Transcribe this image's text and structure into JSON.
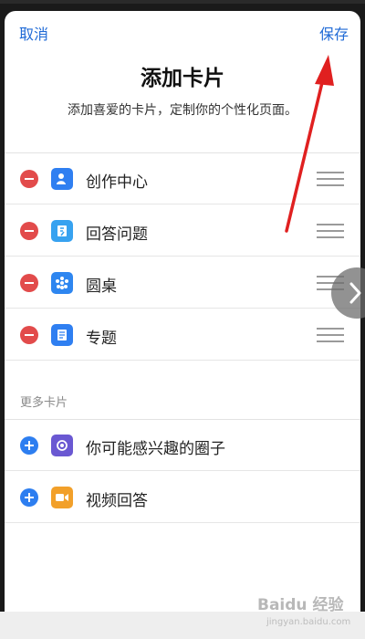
{
  "header": {
    "cancel_label": "取消",
    "save_label": "保存",
    "title": "添加卡片",
    "subtitle": "添加喜爱的卡片，定制你的个性化页面。"
  },
  "added_cards": [
    {
      "label": "创作中心",
      "icon": "creator-icon",
      "color": "#2f7ff1"
    },
    {
      "label": "回答问题",
      "icon": "answer-icon",
      "color": "#37a2f0"
    },
    {
      "label": "圆桌",
      "icon": "roundtable-icon",
      "color": "#2e86f0"
    },
    {
      "label": "专题",
      "icon": "topic-icon",
      "color": "#2f7ff1"
    }
  ],
  "more_section_label": "更多卡片",
  "more_cards": [
    {
      "label": "你可能感兴趣的圈子",
      "icon": "circle-icon",
      "color": "#6a58d2"
    },
    {
      "label": "视频回答",
      "icon": "video-icon",
      "color": "#f2a02a"
    }
  ],
  "colors": {
    "accent": "#1f6ad6",
    "remove": "#e24b4b",
    "add": "#2d7ef0",
    "annotation_arrow": "#e02020"
  },
  "watermark": {
    "text": "Baidu 经验",
    "sub": "jingyan.baidu.com"
  }
}
